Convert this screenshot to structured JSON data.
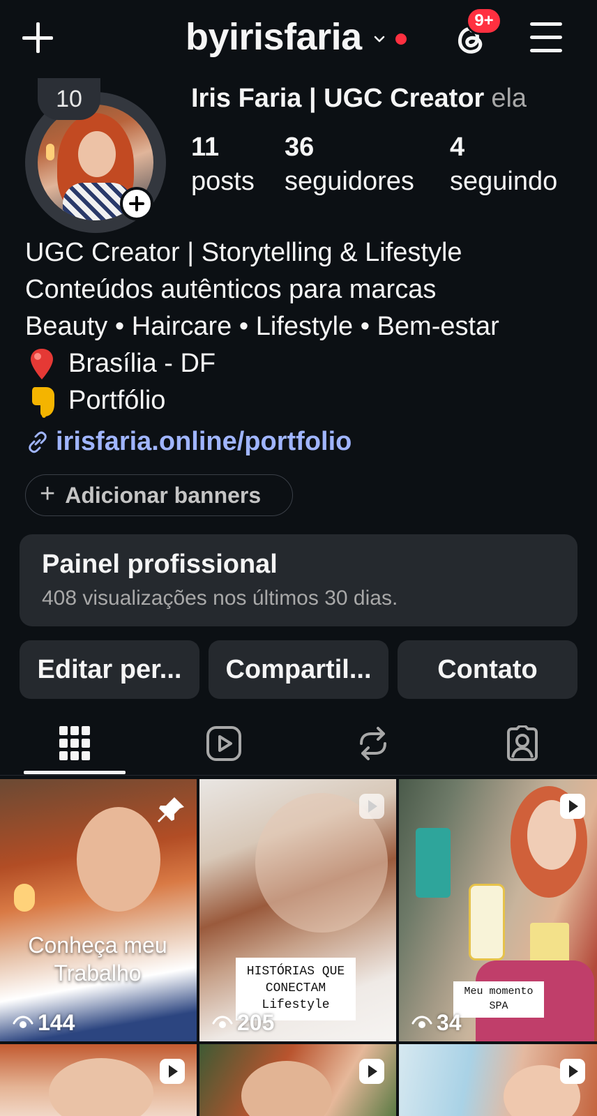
{
  "header": {
    "username": "byirisfaria",
    "notification_badge": "9+"
  },
  "profile": {
    "note": "10",
    "display_name": "Iris Faria | UGC Creator",
    "pronouns": "ela",
    "stats": [
      {
        "value": "11",
        "label": "posts"
      },
      {
        "value": "36",
        "label": "seguidores"
      },
      {
        "value": "4",
        "label": "seguindo"
      }
    ],
    "bio": [
      "UGC Creator | Storytelling & Lifestyle",
      "Conteúdos autênticos para marcas",
      "Beauty • Haircare • Lifestyle • Bem-estar",
      "Brasília - DF",
      "Portfólio"
    ],
    "link": "irisfaria.online/portfolio",
    "add_banners_label": "Adicionar banners"
  },
  "dashboard": {
    "title": "Painel profissional",
    "subtitle": "408 visualizações nos últimos 30 dias."
  },
  "actions": {
    "edit": "Editar per...",
    "share": "Compartil...",
    "contact": "Contato"
  },
  "tabs": [
    "grid-icon",
    "reels-icon",
    "reposts-icon",
    "tagged-icon"
  ],
  "posts": [
    {
      "views": "144",
      "caption": "Conheça meu Trabalho",
      "caption_line1": "Conheça meu",
      "caption_line2": "Trabalho",
      "pinned": true
    },
    {
      "views": "205",
      "caption_line1": "HISTÓRIAS QUE",
      "caption_line2": "CONECTAM",
      "caption_line3": "Lifestyle"
    },
    {
      "views": "34",
      "caption_line1": "Meu momento",
      "caption_line2": "SPA"
    }
  ],
  "colors": {
    "background": "#0c1014",
    "card": "#25292e",
    "link": "#a0b5ff",
    "badge": "#ff3040"
  }
}
